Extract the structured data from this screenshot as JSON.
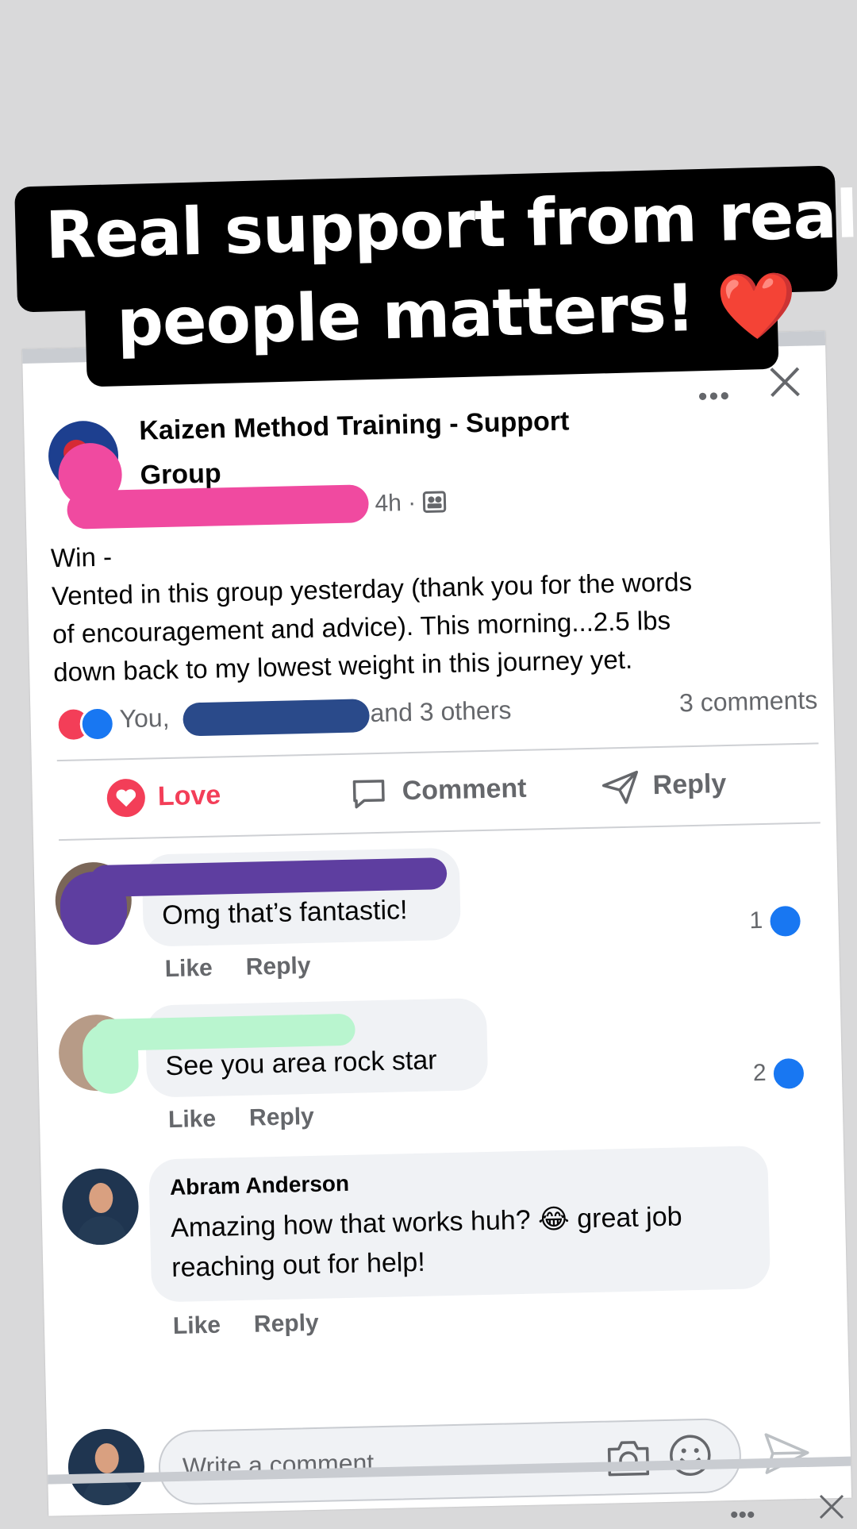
{
  "caption": {
    "line1": "Real support from real",
    "line2": "people matters!",
    "emoji": "❤️"
  },
  "post": {
    "group_title": "Kaizen Method Training - Support Group",
    "meta_time": "4h ·",
    "more_icon": "more-horizontal-icon",
    "close_icon": "close-icon",
    "body_lines": [
      "Win -",
      "Vented in this group yesterday (thank you for the words",
      "of encouragement and advice). This morning...2.5 lbs",
      "down back to my lowest weight in this journey yet."
    ],
    "reactions_prefix": "You,",
    "reactions_suffix": "and 3 others",
    "comments_count": "3 comments"
  },
  "actions": {
    "love": "Love",
    "comment": "Comment",
    "reply": "Reply"
  },
  "comments": [
    {
      "name": "",
      "text": "Omg that’s fantastic!",
      "like": "Like",
      "reply": "Reply",
      "likes": "1"
    },
    {
      "name": "",
      "text": "See you area rock star",
      "like": "Like",
      "reply": "Reply",
      "likes": "2"
    },
    {
      "name": "Abram Anderson",
      "text_lines": [
        "Amazing how that works huh? 😂 great job",
        "reaching out for help!"
      ],
      "like": "Like",
      "reply": "Reply"
    }
  ],
  "composer": {
    "placeholder": "Write a comment...",
    "camera_icon": "camera-icon",
    "emoji_icon": "smiley-icon",
    "send_icon": "send-icon"
  },
  "colors": {
    "love": "#f33e58",
    "like": "#1877f2",
    "secondary_text": "#65676b",
    "bubble": "#f0f2f5",
    "redact_pink": "#f04aa0",
    "redact_blue": "#2a4a8a",
    "redact_purple": "#5e3ea0",
    "redact_green": "#b9f5cf"
  }
}
